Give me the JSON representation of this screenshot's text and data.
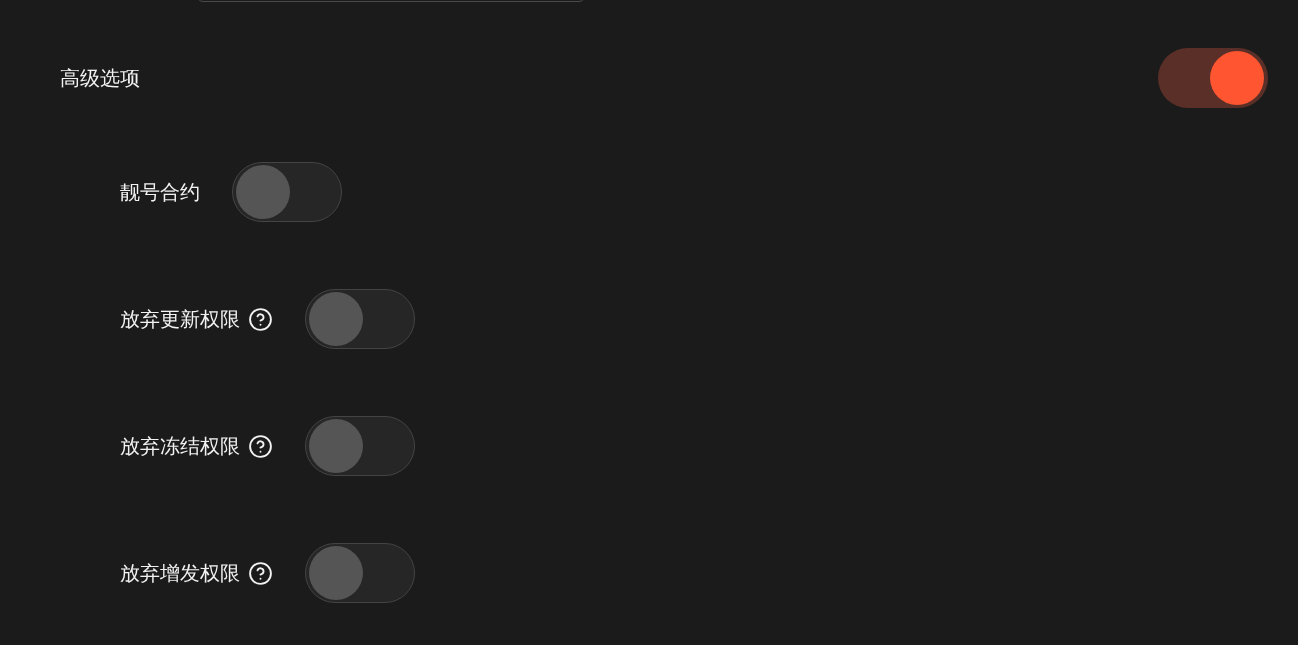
{
  "advanced": {
    "label": "高级选项",
    "on": true
  },
  "options": [
    {
      "label": "靓号合约",
      "help": false,
      "on": false
    },
    {
      "label": "放弃更新权限",
      "help": true,
      "on": false
    },
    {
      "label": "放弃冻结权限",
      "help": true,
      "on": false
    },
    {
      "label": "放弃增发权限",
      "help": true,
      "on": false
    }
  ]
}
